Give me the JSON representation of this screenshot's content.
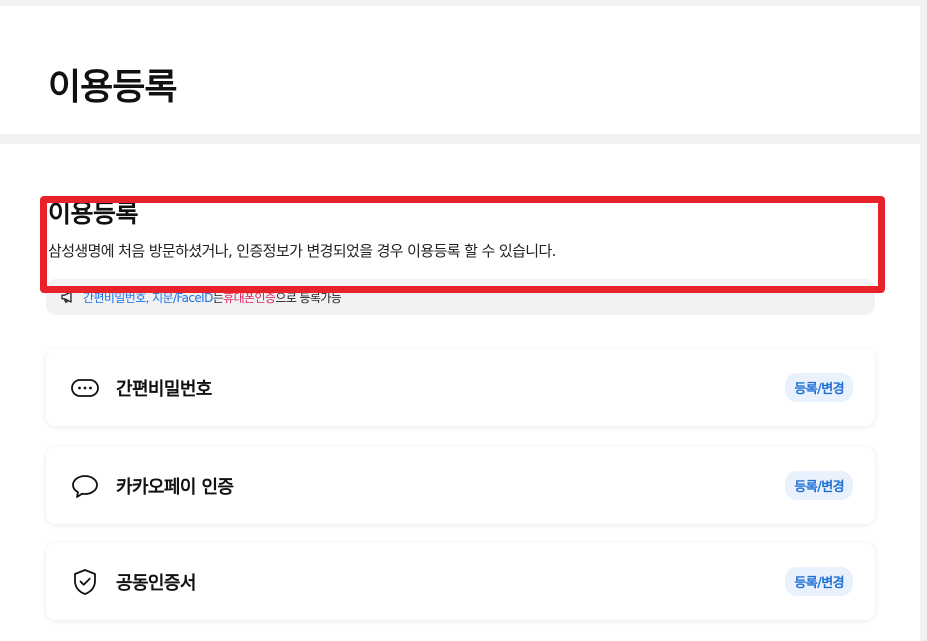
{
  "header": {
    "title": "이용등록"
  },
  "section": {
    "title": "이용등록",
    "description": "삼성생명에 처음 방문하셨거나, 인증정보가 변경되었을 경우 이용등록 할 수 있습니다.",
    "notice": {
      "icon": "megaphone-icon",
      "part1": "간편비밀번호, 지문/FaceID",
      "part2": "는 ",
      "part3": "휴대폰인증",
      "part4": "으로 등록가능",
      "colors": {
        "blue": "#1a73e8",
        "pink": "#e0245e"
      }
    }
  },
  "methods": [
    {
      "icon": "dots-bubble-icon",
      "label": "간편비밀번호",
      "badge": "등록/변경",
      "highlighted": true
    },
    {
      "icon": "speech-bubble-icon",
      "label": "카카오페이 인증",
      "badge": "등록/변경",
      "highlighted": false
    },
    {
      "icon": "shield-check-icon",
      "label": "공동인증서",
      "badge": "등록/변경",
      "highlighted": false
    }
  ],
  "colors": {
    "highlight": "#e8212a",
    "badge_bg": "#e9f2fc",
    "badge_text": "#1f6fd6"
  }
}
